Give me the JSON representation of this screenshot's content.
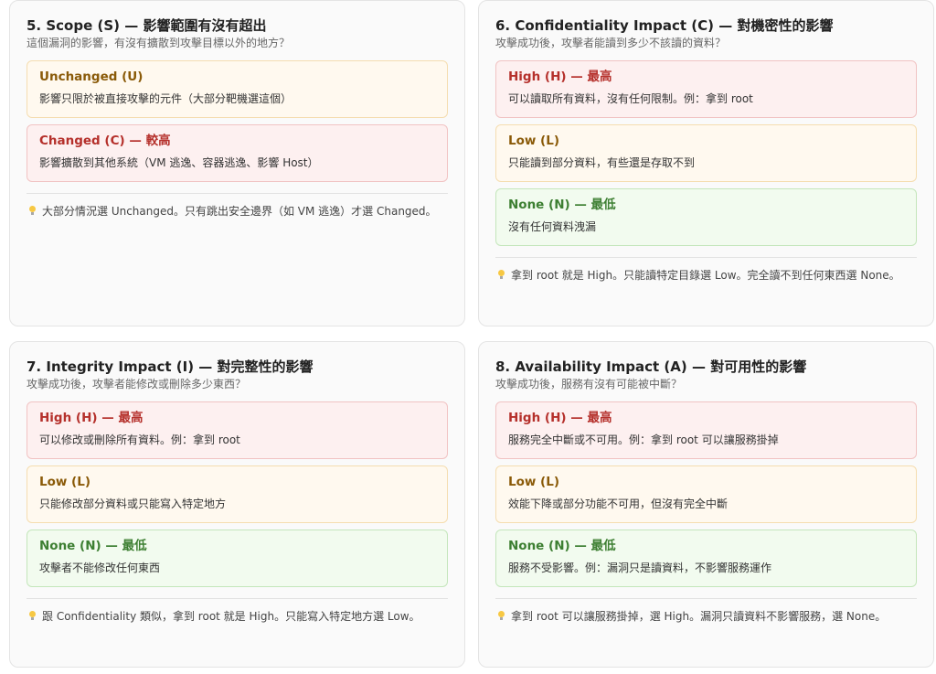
{
  "cards": [
    {
      "title": "5. Scope (S) — 影響範圍有沒有超出",
      "subtitle": "這個漏洞的影響，有沒有擴散到攻擊目標以外的地方？",
      "options": [
        {
          "level": "low",
          "name": "Unchanged (U)",
          "desc": "影響只限於被直接攻擊的元件（大部分靶機選這個）"
        },
        {
          "level": "high",
          "name": "Changed (C) — 較高",
          "desc": "影響擴散到其他系統（VM 逃逸、容器逃逸、影響 Host）"
        }
      ],
      "tip_icon": "lightbulb-icon",
      "tip": "大部分情況選 Unchanged。只有跳出安全邊界（如 VM 逃逸）才選 Changed。"
    },
    {
      "title": "6. Confidentiality Impact (C) — 對機密性的影響",
      "subtitle": "攻擊成功後，攻擊者能讀到多少不該讀的資料？",
      "options": [
        {
          "level": "high",
          "name": "High (H) — 最高",
          "desc": "可以讀取所有資料，沒有任何限制。例：拿到 root"
        },
        {
          "level": "low",
          "name": "Low (L)",
          "desc": "只能讀到部分資料，有些還是存取不到"
        },
        {
          "level": "none",
          "name": "None (N) — 最低",
          "desc": "沒有任何資料洩漏"
        }
      ],
      "tip_icon": "lightbulb-icon",
      "tip": "拿到 root 就是 High。只能讀特定目錄選 Low。完全讀不到任何東西選 None。"
    },
    {
      "title": "7. Integrity Impact (I) — 對完整性的影響",
      "subtitle": "攻擊成功後，攻擊者能修改或刪除多少東西？",
      "options": [
        {
          "level": "high",
          "name": "High (H) — 最高",
          "desc": "可以修改或刪除所有資料。例：拿到 root"
        },
        {
          "level": "low",
          "name": "Low (L)",
          "desc": "只能修改部分資料或只能寫入特定地方"
        },
        {
          "level": "none",
          "name": "None (N) — 最低",
          "desc": "攻擊者不能修改任何東西"
        }
      ],
      "tip_icon": "lightbulb-icon",
      "tip": "跟 Confidentiality 類似，拿到 root 就是 High。只能寫入特定地方選 Low。"
    },
    {
      "title": "8. Availability Impact (A) — 對可用性的影響",
      "subtitle": "攻擊成功後，服務有沒有可能被中斷？",
      "options": [
        {
          "level": "high",
          "name": "High (H) — 最高",
          "desc": "服務完全中斷或不可用。例：拿到 root 可以讓服務掛掉"
        },
        {
          "level": "low",
          "name": "Low (L)",
          "desc": "效能下降或部分功能不可用，但沒有完全中斷"
        },
        {
          "level": "none",
          "name": "None (N) — 最低",
          "desc": "服務不受影響。例：漏洞只是讀資料，不影響服務運作"
        }
      ],
      "tip_icon": "lightbulb-icon",
      "tip": "拿到 root 可以讓服務掛掉，選 High。漏洞只讀資料不影響服務，選 None。"
    }
  ]
}
